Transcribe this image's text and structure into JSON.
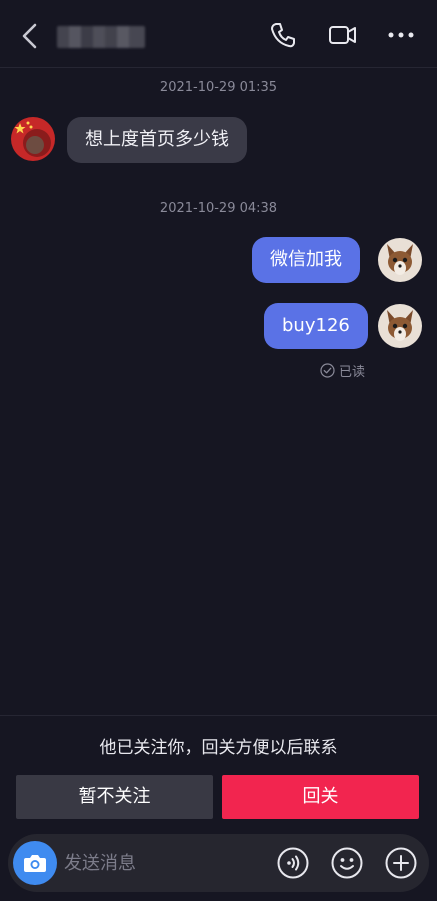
{
  "header": {
    "contact_name_obscured": "",
    "icons": [
      "back-arrow-icon",
      "phone-icon",
      "video-icon",
      "more-icon"
    ]
  },
  "messages": [
    {
      "type": "timestamp",
      "text": "2021-10-29 01:35"
    },
    {
      "type": "incoming",
      "text": "想上度首页多少钱"
    },
    {
      "type": "timestamp",
      "text": "2021-10-29 04:38"
    },
    {
      "type": "outgoing",
      "text": "微信加我"
    },
    {
      "type": "outgoing",
      "text": "buy126"
    }
  ],
  "read_status": "已读",
  "follow_prompt": {
    "text": "他已关注你，回关方便以后联系",
    "ignore_label": "暂不关注",
    "follow_label": "回关"
  },
  "composer": {
    "placeholder": "发送消息",
    "icons": [
      "camera-icon",
      "voice-icon",
      "emoji-icon",
      "plus-icon"
    ]
  },
  "colors": {
    "background": "#161622",
    "incoming_bubble": "#3a3a47",
    "outgoing_bubble": "#5a72e6",
    "follow_button": "#f2254f",
    "ignore_button": "#393944",
    "camera_button": "#3f8bf0"
  }
}
